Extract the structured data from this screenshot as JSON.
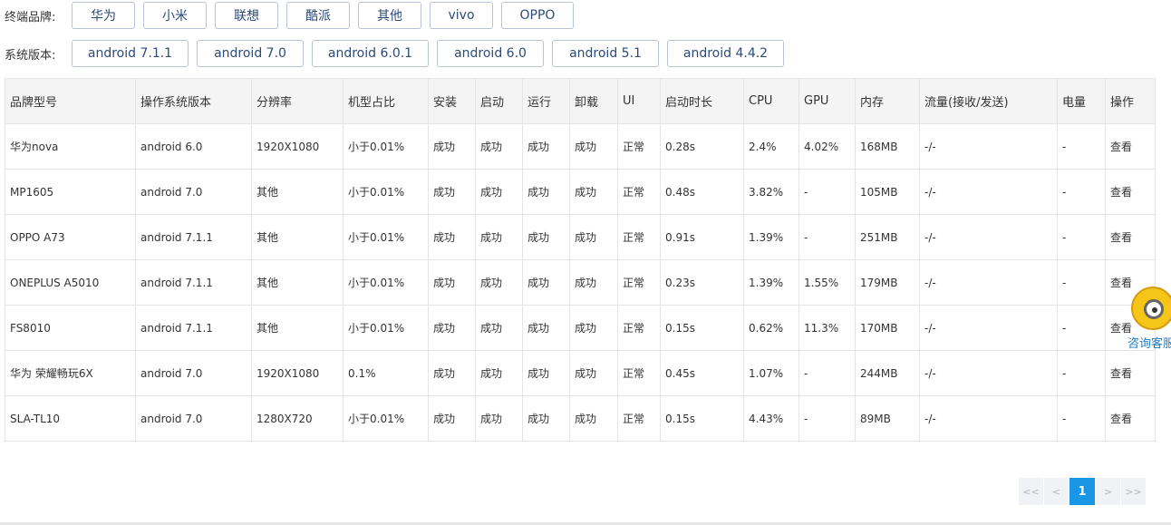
{
  "filters": {
    "brand": {
      "label": "终端品牌:",
      "options": [
        "华为",
        "小米",
        "联想",
        "酷派",
        "其他",
        "vivo",
        "OPPO"
      ]
    },
    "os": {
      "label": "系统版本:",
      "options": [
        "android 7.1.1",
        "android 7.0",
        "android 6.0.1",
        "android 6.0",
        "android 5.1",
        "android 4.4.2"
      ]
    }
  },
  "table": {
    "headers": [
      "品牌型号",
      "操作系统版本",
      "分辨率",
      "机型占比",
      "安装",
      "启动",
      "运行",
      "卸载",
      "UI",
      "启动时长",
      "CPU",
      "GPU",
      "内存",
      "流量(接收/发送)",
      "电量",
      "操作"
    ],
    "rows": [
      [
        "华为nova",
        "android 6.0",
        "1920X1080",
        "小于0.01%",
        "成功",
        "成功",
        "成功",
        "成功",
        "正常",
        "0.28s",
        "2.4%",
        "4.02%",
        "168MB",
        "-/-",
        "-",
        "查看"
      ],
      [
        "MP1605",
        "android 7.0",
        "其他",
        "小于0.01%",
        "成功",
        "成功",
        "成功",
        "成功",
        "正常",
        "0.48s",
        "3.82%",
        "-",
        "105MB",
        "-/-",
        "-",
        "查看"
      ],
      [
        "OPPO A73",
        "android 7.1.1",
        "其他",
        "小于0.01%",
        "成功",
        "成功",
        "成功",
        "成功",
        "正常",
        "0.91s",
        "1.39%",
        "-",
        "251MB",
        "-/-",
        "-",
        "查看"
      ],
      [
        "ONEPLUS A5010",
        "android 7.1.1",
        "其他",
        "小于0.01%",
        "成功",
        "成功",
        "成功",
        "成功",
        "正常",
        "0.23s",
        "1.39%",
        "1.55%",
        "179MB",
        "-/-",
        "-",
        "查看"
      ],
      [
        "FS8010",
        "android 7.1.1",
        "其他",
        "小于0.01%",
        "成功",
        "成功",
        "成功",
        "成功",
        "正常",
        "0.15s",
        "0.62%",
        "11.3%",
        "170MB",
        "-/-",
        "-",
        "查看"
      ],
      [
        "华为 荣耀畅玩6X",
        "android 7.0",
        "1920X1080",
        "0.1%",
        "成功",
        "成功",
        "成功",
        "成功",
        "正常",
        "0.45s",
        "1.07%",
        "-",
        "244MB",
        "-/-",
        "-",
        "查看"
      ],
      [
        "SLA-TL10",
        "android 7.0",
        "1280X720",
        "小于0.01%",
        "成功",
        "成功",
        "成功",
        "成功",
        "正常",
        "0.15s",
        "4.43%",
        "-",
        "89MB",
        "-/-",
        "-",
        "查看"
      ]
    ]
  },
  "pagination": {
    "first": "<<",
    "prev": "<",
    "current": "1",
    "next": ">",
    "last": ">>"
  },
  "consult": {
    "label": "咨询客服",
    "icon": "customer-service-icon"
  },
  "colors": {
    "success": "#5aad4e",
    "link": "#1f7ec6",
    "active_page": "#1996e6"
  }
}
